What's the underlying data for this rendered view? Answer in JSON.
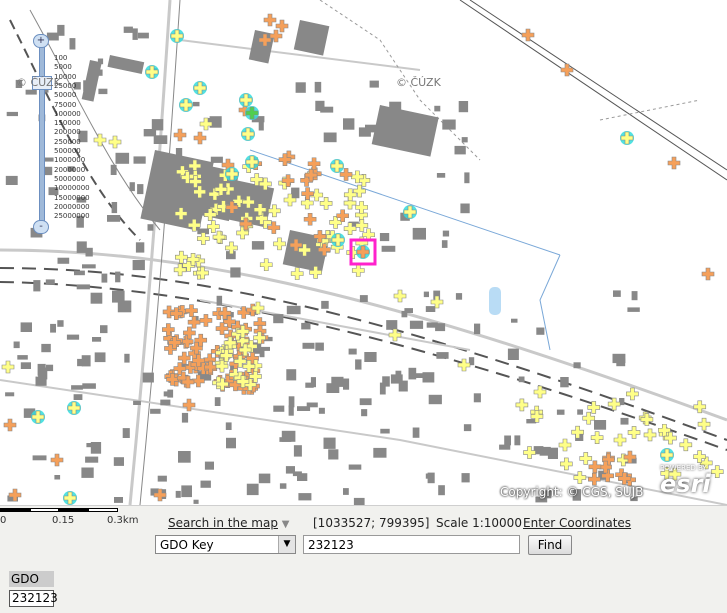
{
  "map": {
    "attribution_cuzk": "© ČÚZK",
    "copyright": "Copyright: © CGS, SUJB",
    "esri_powered": "POWERED BY",
    "esri_logo": "esri",
    "zoom_levels": [
      "100",
      "5000",
      "10000",
      "25000",
      "50000",
      "75000",
      "100000",
      "150000",
      "200000",
      "250000",
      "500000",
      "1000000",
      "2000000",
      "5000000",
      "10000000",
      "15000000",
      "20000000",
      "25000000"
    ],
    "zoom_in": "+",
    "zoom_out": "-",
    "marker_colors": {
      "yellow": "#ffff88",
      "orange": "#f5a05a",
      "cyan_halo": "#33dddd",
      "selected": "#ff22cc",
      "green": "#4fcf4f"
    }
  },
  "scalebar": {
    "label_0": "0",
    "label_mid": "0.15",
    "label_end": "0.3km"
  },
  "toolbar": {
    "search_link": "Search in the map",
    "coordinates": "[1033527; 799395]",
    "scale_text": "Scale 1:10000",
    "enter_coords": "Enter Coordinates",
    "key_select": "GDO Key",
    "search_value": "232123",
    "find_button": "Find"
  },
  "result": {
    "header": "GDO",
    "value": "232123"
  }
}
